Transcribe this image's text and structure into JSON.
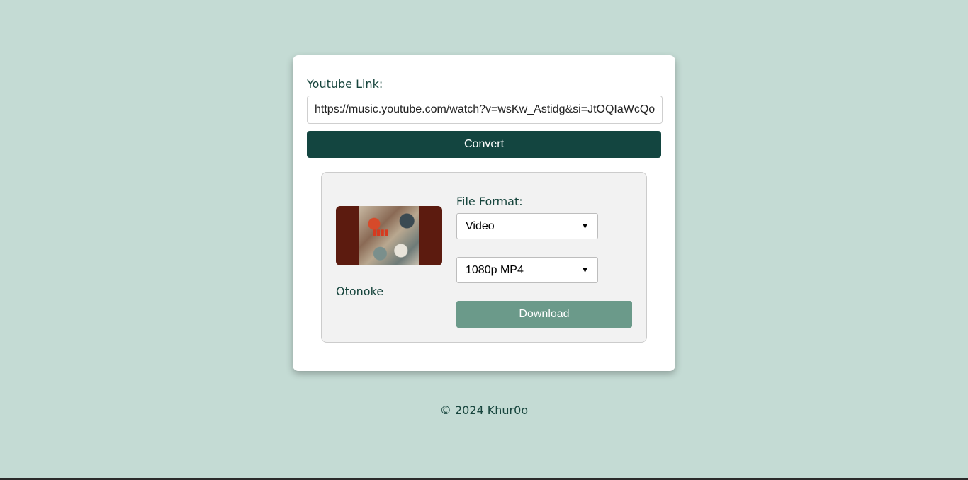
{
  "form": {
    "link_label": "Youtube Link:",
    "link_value": "https://music.youtube.com/watch?v=wsKw_Astidg&si=JtOQIaWcQo",
    "convert_label": "Convert"
  },
  "result": {
    "title": "Otonoke",
    "format_label": "File Format:",
    "format_selected": "Video",
    "quality_selected": "1080p MP4",
    "download_label": "Download"
  },
  "footer": {
    "text": "© 2024 Khur0o"
  },
  "colors": {
    "background": "#c4dbd4",
    "primary": "#134540",
    "download": "#6b9a8a"
  }
}
